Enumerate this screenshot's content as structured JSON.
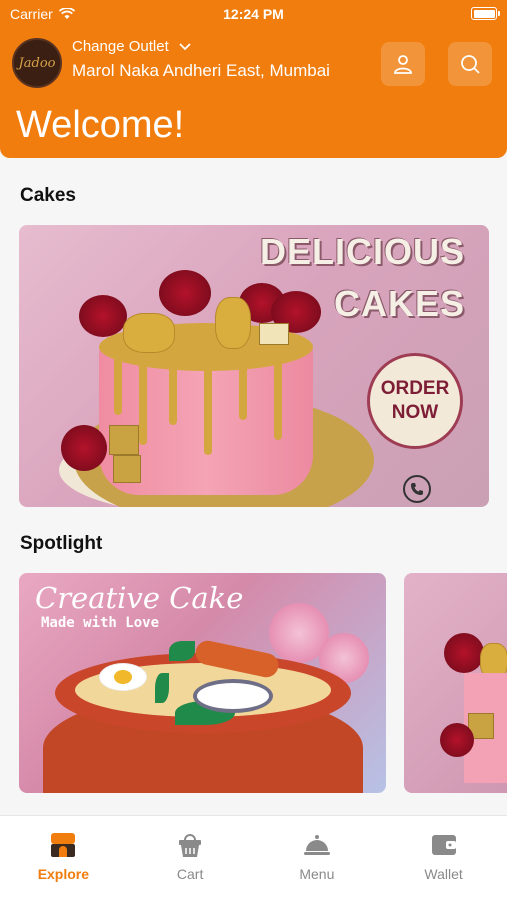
{
  "status_bar": {
    "carrier": "Carrier",
    "time": "12:24 PM"
  },
  "header": {
    "logo_text": "Jadoo",
    "outlet_label": "Change Outlet",
    "outlet_address": "Marol Naka Andheri East, Mumbai",
    "profile_icon": "user-icon",
    "search_icon": "search-icon",
    "welcome": "Welcome!",
    "accent_color": "#f07d0e"
  },
  "sections": {
    "cakes": {
      "title": "Cakes",
      "banner": {
        "headline_1": "DELICIOUS",
        "headline_2": "CAKES",
        "badge_line_1": "ORDER",
        "badge_line_2": "NOW",
        "icon": "phone-icon"
      }
    },
    "spotlight": {
      "title": "Spotlight",
      "banner": {
        "title": "Creative Cake",
        "subtitle": "Made with Love"
      }
    }
  },
  "tabbar": {
    "tabs": [
      {
        "label": "Explore",
        "icon": "explore-icon",
        "active": true
      },
      {
        "label": "Cart",
        "icon": "cart-icon",
        "active": false
      },
      {
        "label": "Menu",
        "icon": "cloche-icon",
        "active": false
      },
      {
        "label": "Wallet",
        "icon": "wallet-icon",
        "active": false
      }
    ]
  }
}
